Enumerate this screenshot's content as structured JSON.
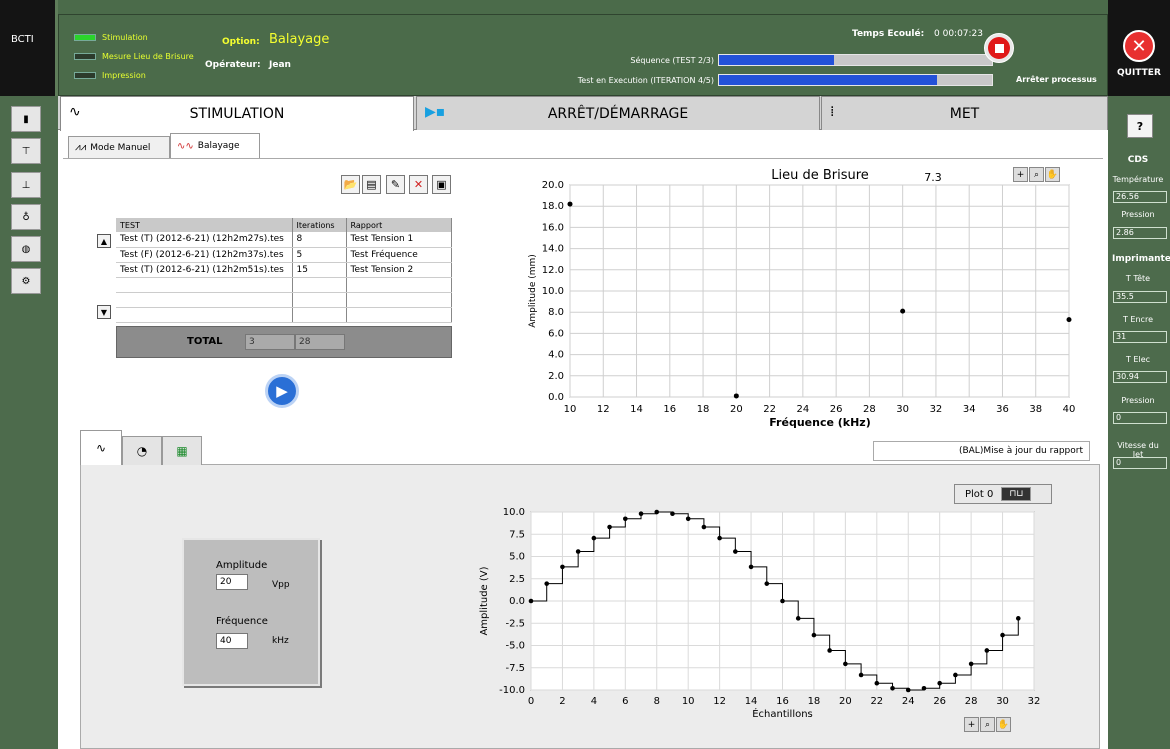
{
  "app": {
    "brand": "BCTI"
  },
  "header": {
    "leds": [
      {
        "label": "Stimulation",
        "on": true
      },
      {
        "label": "Mesure Lieu de Brisure",
        "on": false
      },
      {
        "label": "Impression",
        "on": false
      }
    ],
    "option_label": "Option:",
    "option_value": "Balayage",
    "operator_label": "Opérateur:",
    "operator_value": "Jean",
    "elapsed_label": "Temps Ecoulé:",
    "elapsed_value": "0 00:07:23",
    "sequence_label": "Séquence (TEST 2/3)",
    "sequence_progress": 0.42,
    "execution_label": "Test en Execution (ITERATION 4/5)",
    "execution_progress": 0.8,
    "stop_label": "Arrêter processus",
    "quit_label": "QUITTER"
  },
  "main_tabs": [
    {
      "label": "STIMULATION",
      "active": true
    },
    {
      "label": "ARRÊT/DÉMARRAGE",
      "active": false
    },
    {
      "label": "MET",
      "active": false
    }
  ],
  "sub_tabs": [
    {
      "label": "Mode Manuel",
      "active": false
    },
    {
      "label": "Balayage",
      "active": true
    }
  ],
  "test_table": {
    "columns": [
      "TEST",
      "Iterations",
      "Rapport"
    ],
    "rows": [
      [
        "Test (T) (2012-6-21) (12h2m27s).tes",
        "8",
        "Test Tension 1"
      ],
      [
        "Test (F) (2012-6-21) (12h2m37s).tes",
        "5",
        "Test Fréquence"
      ],
      [
        "Test (T) (2012-6-21) (12h2m51s).tes",
        "15",
        "Test Tension 2"
      ],
      [
        "",
        "",
        ""
      ],
      [
        "",
        "",
        ""
      ],
      [
        "",
        "",
        ""
      ]
    ],
    "total_label": "TOTAL",
    "total_tests": "3",
    "total_iterations": "28"
  },
  "status_text": "(BAL)Mise à jour du rapport",
  "params": {
    "amplitude_label": "Amplitude",
    "amplitude_value": "20",
    "amplitude_unit": "Vpp",
    "frequency_label": "Fréquence",
    "frequency_value": "40",
    "frequency_unit": "kHz"
  },
  "plot_legend": "Plot 0",
  "sidebar_right": {
    "cds_title": "CDS",
    "temperature_label": "Température",
    "temperature_value": "26.56",
    "pression_label": "Pression",
    "pression_value": "2.86",
    "printer_title": "Imprimante",
    "t_tete_label": "T Tête",
    "t_tete_value": "35.5",
    "t_encre_label": "T Encre",
    "t_encre_value": "31",
    "t_elec_label": "T Elec",
    "t_elec_value": "30.94",
    "pression2_label": "Pression",
    "pression2_value": "0",
    "jet_label": "Vitesse du Jet",
    "jet_value": "0"
  },
  "chart_data": [
    {
      "type": "scatter",
      "title": "Lieu de Brisure",
      "annotation": "7.3",
      "xlabel": "Fréquence (kHz)",
      "ylabel": "Amplitude (mm)",
      "xlim": [
        10,
        40
      ],
      "ylim": [
        0,
        20
      ],
      "x_ticks": [
        10,
        12,
        14,
        16,
        18,
        20,
        22,
        24,
        26,
        28,
        30,
        32,
        34,
        36,
        38,
        40
      ],
      "y_ticks": [
        "0.0",
        "2.0",
        "4.0",
        "6.0",
        "8.0",
        "10.0",
        "12.0",
        "14.0",
        "16.0",
        "18.0",
        "20.0"
      ],
      "grid": true,
      "x": [
        10,
        20,
        30,
        40
      ],
      "y": [
        18.2,
        0.1,
        8.1,
        7.3
      ]
    },
    {
      "type": "line",
      "step": true,
      "xlabel": "Échantillons",
      "ylabel": "Amplitude (V)",
      "xlim": [
        0,
        32
      ],
      "ylim": [
        -10,
        10
      ],
      "x_ticks": [
        0,
        2,
        4,
        6,
        8,
        10,
        12,
        14,
        16,
        18,
        20,
        22,
        24,
        26,
        28,
        30,
        32
      ],
      "y_ticks": [
        "-10.0",
        "-7.5",
        "-5.0",
        "-2.5",
        "0.0",
        "2.5",
        "5.0",
        "7.5",
        "10.0"
      ],
      "grid": true,
      "series": [
        {
          "name": "Plot 0",
          "x": [
            0,
            1,
            2,
            3,
            4,
            5,
            6,
            7,
            8,
            9,
            10,
            11,
            12,
            13,
            14,
            15,
            16,
            17,
            18,
            19,
            20,
            21,
            22,
            23,
            24,
            25,
            26,
            27,
            28,
            29,
            30,
            31
          ],
          "values": [
            0,
            1.95,
            3.83,
            5.56,
            7.07,
            8.31,
            9.24,
            9.81,
            10,
            9.81,
            9.24,
            8.31,
            7.07,
            5.56,
            3.83,
            1.95,
            0,
            -1.95,
            -3.83,
            -5.56,
            -7.07,
            -8.31,
            -9.24,
            -9.81,
            -10,
            -9.81,
            -9.24,
            -8.31,
            -7.07,
            -5.56,
            -3.83,
            -1.95
          ]
        }
      ]
    }
  ]
}
